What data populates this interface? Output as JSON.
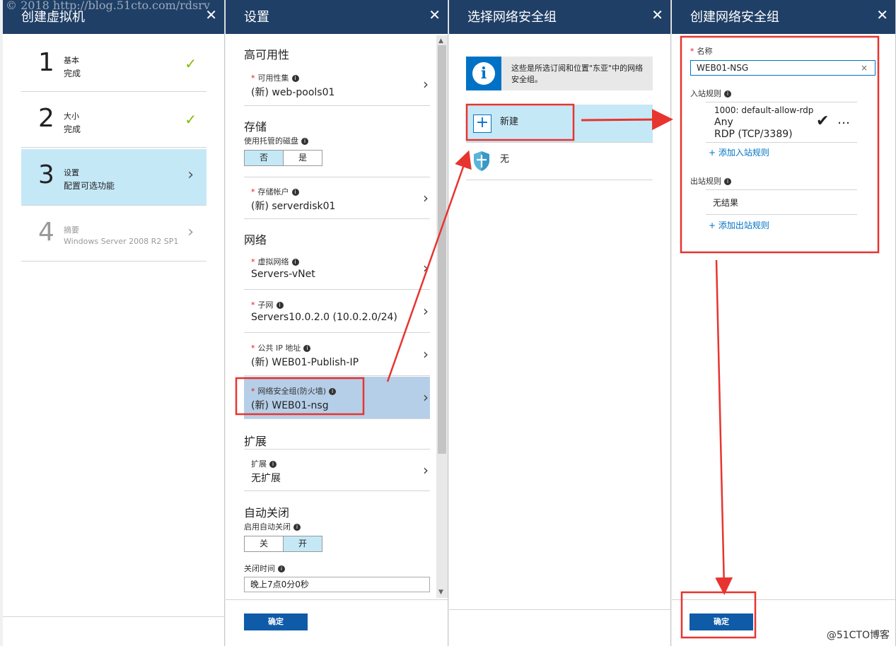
{
  "watermark": "© 2018 http://blog.51cto.com/rdsrv",
  "close_glyph": "✕",
  "blade1": {
    "title": "创建虚拟机",
    "steps": [
      {
        "num": "1",
        "title": "基本",
        "subtitle": "完成",
        "state": "done"
      },
      {
        "num": "2",
        "title": "大小",
        "subtitle": "完成",
        "state": "done"
      },
      {
        "num": "3",
        "title": "设置",
        "subtitle": "配置可选功能",
        "state": "selected"
      },
      {
        "num": "4",
        "title": "摘要",
        "subtitle": "Windows Server 2008 R2 SP1",
        "state": "disabled"
      }
    ]
  },
  "blade2": {
    "title": "设置",
    "sections": {
      "ha": "高可用性",
      "storage": "存储",
      "network": "网络",
      "ext": "扩展",
      "autoshutdown": "自动关闭"
    },
    "availability_set": {
      "label": "可用性集",
      "value": "(新) web-pools01"
    },
    "managed_disk": {
      "label": "使用托管的磁盘",
      "options": [
        "否",
        "是"
      ],
      "selected": "否"
    },
    "storage_account": {
      "label": "存储帐户",
      "value": "(新) serverdisk01"
    },
    "vnet": {
      "label": "虚拟网络",
      "value": "Servers-vNet"
    },
    "subnet": {
      "label": "子网",
      "value": "Servers10.0.2.0 (10.0.2.0/24)"
    },
    "public_ip": {
      "label": "公共 IP 地址",
      "value": "(新) WEB01-Publish-IP"
    },
    "nsg": {
      "label": "网络安全组(防火墙)",
      "value": "(新) WEB01-nsg"
    },
    "extensions": {
      "label": "扩展",
      "value": "无扩展"
    },
    "auto_shutdown": {
      "label": "启用自动关闭",
      "options": [
        "关",
        "开"
      ],
      "selected": "开"
    },
    "shutdown_time": {
      "label": "关闭时间",
      "value": "晚上7点0分0秒"
    },
    "ok": "确定"
  },
  "blade3": {
    "title": "选择网络安全组",
    "info_text": "这些是所选订阅和位置\"东亚\"中的网络安全组。",
    "create_new": "新建",
    "none": "无"
  },
  "blade4": {
    "title": "创建网络安全组",
    "name_label": "名称",
    "name_value": "WEB01-NSG",
    "inbound_label": "入站规则",
    "inbound_rule": {
      "name": "1000: default-allow-rdp",
      "source": "Any",
      "port": "RDP (TCP/3389)"
    },
    "add_inbound": "+ 添加入站规则",
    "outbound_label": "出站规则",
    "no_results": "无结果",
    "add_outbound": "+ 添加出站规则",
    "ok": "确定"
  },
  "brand": "@51CTO博客",
  "colors": {
    "header": "#1f3f66",
    "selected": "#c5e8f7",
    "selected_row": "#b6cfe8",
    "accent": "#0072c6",
    "check": "#7fba00",
    "annotation": "#e8342f"
  }
}
